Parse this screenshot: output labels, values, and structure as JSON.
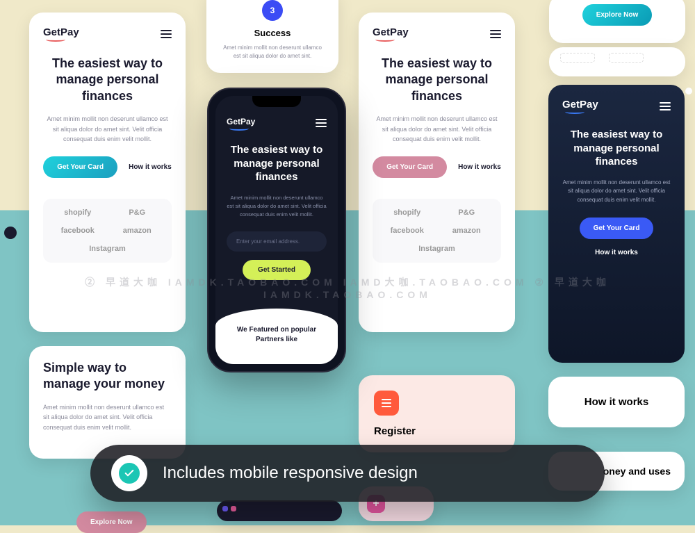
{
  "brand": "GetPay",
  "hero": {
    "title": "The easiest way to manage personal finances",
    "desc": "Amet minim mollit non deserunt ullamco est sit aliqua dolor do amet sint. Velit officia consequat duis enim velit mollit."
  },
  "actions": {
    "get_card": "Get Your Card",
    "how_it_works": "How it works",
    "get_started": "Get Started",
    "explore_now": "Explore Now"
  },
  "partners_label": "We Featured on popular Partners like",
  "partners": {
    "p1": "shopify",
    "p2": "P&G",
    "p3": "facebook",
    "p4": "amazon",
    "p5": "Instagram"
  },
  "simple": {
    "title": "Simple way to manage your money",
    "desc": "Amet minim mollit non deserunt ullamco est sit aliqua dolor do amet sint. Velit officia consequat duis enim velit mollit."
  },
  "success": {
    "step": "3",
    "title": "Success",
    "desc": "Amet minim mollit non deserunt ullamco est sit aliqua dolor do amet sint."
  },
  "register": {
    "title": "Register"
  },
  "phone": {
    "email_placeholder": "Enter your email address."
  },
  "howitworks": "How it works",
  "moneybonus": "oney and uses",
  "banner": "Includes mobile responsive design",
  "watermark": "② 早道大咖  IAMDK.TAOBAO.COM   IAMD大咖.TAOBAO.COM   ② 早道大咖  IAMDK.TAOBAO.COM"
}
